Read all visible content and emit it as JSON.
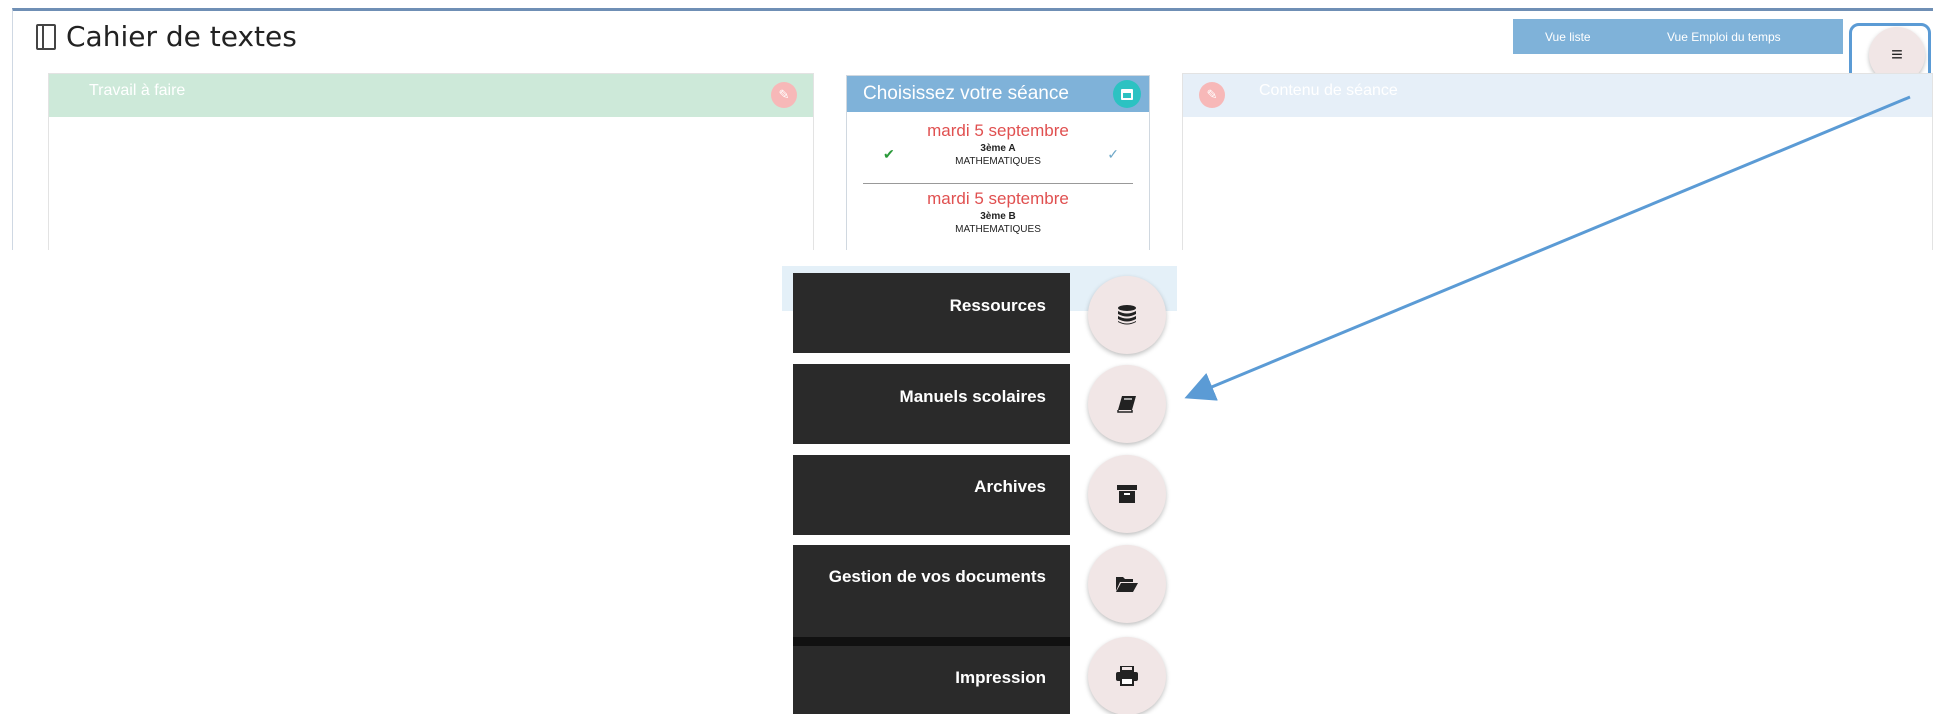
{
  "header": {
    "title": "Cahier de textes",
    "view_list_label": "Vue liste",
    "view_schedule_label": "Vue Emploi du temps"
  },
  "panels": {
    "left_title": "Travail à faire",
    "middle_title": "Choisissez votre séance",
    "right_title": "Contenu de séance"
  },
  "seances": [
    {
      "date": "mardi 5 septembre",
      "classe": "3ème A",
      "matiere": "MATHEMATIQUES"
    },
    {
      "date": "mardi 5 septembre",
      "classe": "3ème B",
      "matiere": "MATHEMATIQUES"
    }
  ],
  "fab_menu": {
    "items": [
      {
        "label": "Ressources",
        "icon": "database-icon"
      },
      {
        "label": "Manuels scolaires",
        "icon": "book-icon"
      },
      {
        "label": "Archives",
        "icon": "archive-icon"
      },
      {
        "label": "Gestion de vos documents",
        "icon": "folder-open-icon"
      },
      {
        "label": "Impression",
        "icon": "print-icon"
      }
    ]
  },
  "colors": {
    "accent_blue": "#7fb2d9",
    "work_header_green": "#cde9d9",
    "date_red": "#e05050",
    "fab_dark": "#2a2a2a",
    "highlight_frame": "#5b9bd5"
  }
}
